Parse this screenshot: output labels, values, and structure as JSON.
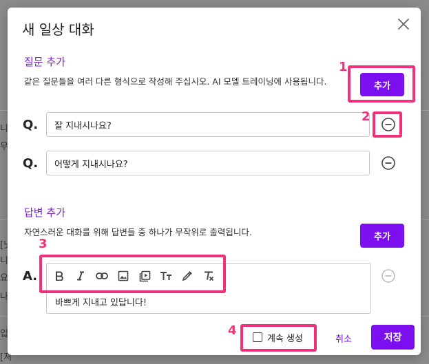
{
  "background": {
    "fragments": [
      "니",
      "무",
      "[닛",
      "니",
      "요.",
      "나",
      "입",
      "[져"
    ]
  },
  "modal": {
    "title": "새 일상 대화",
    "close_icon": "close-icon",
    "question_section": {
      "title": "질문 추가",
      "description": "같은 질문들을 여러 다른 형식으로 작성해 주십시오. AI 모델 트레이닝에 사용됩니다.",
      "add_label": "추가",
      "prefix": "Q.",
      "items": [
        {
          "value": "잘 지내시나요?"
        },
        {
          "value": "어떻게 지내시나요?"
        }
      ]
    },
    "answer_section": {
      "title": "답변 추가",
      "description": "자연스러운 대화를 위해 답변들 중 하나가 무작위로 출력됩니다.",
      "add_label": "추가",
      "prefix": "A.",
      "toolbar": [
        "bold-icon",
        "italic-icon",
        "link-icon",
        "image-icon",
        "video-icon",
        "text-size-icon",
        "color-picker-icon",
        "clear-format-icon"
      ],
      "items": [
        {
          "value": "바쁘게 지내고 있답니다!"
        }
      ]
    },
    "footer": {
      "continue_label": "계속 생성",
      "continue_checked": false,
      "cancel_label": "취소",
      "save_label": "저장"
    }
  },
  "annotations": [
    "1",
    "2",
    "3",
    "4"
  ],
  "colors": {
    "accent": "#7c0ff0",
    "highlight": "#f0307a",
    "section_title": "#7b1fd0"
  }
}
